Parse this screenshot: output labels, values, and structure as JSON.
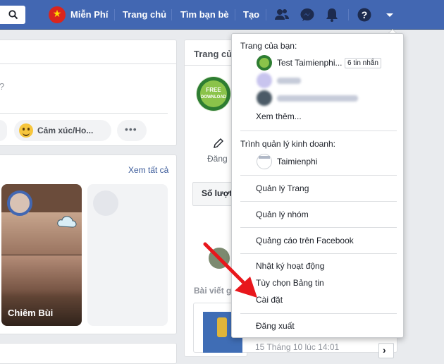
{
  "topbar": {
    "user_name": "Miễn Phí",
    "home": "Trang chủ",
    "find_friends": "Tìm bạn bè",
    "create": "Tạo"
  },
  "composer": {
    "prompt_fragment": "?",
    "feeling_label": "Cảm xúc/Ho..."
  },
  "stories": {
    "see_all": "Xem tất cả",
    "story_name": "Chiêm Bùi"
  },
  "right_panel": {
    "pages_title": "Trang củ",
    "edit_label": "Đăng",
    "views_label": "Số lượt",
    "posts_title": "Bài viết g",
    "post_date": "15 Tháng 10 lúc 14:01"
  },
  "dropdown": {
    "your_pages_heading": "Trang của bạn:",
    "pages": [
      {
        "name": "Test Taimienphi...",
        "badge": "6 tin nhắn"
      }
    ],
    "see_more": "Xem thêm...",
    "business_heading": "Trình quản lý kinh doanh:",
    "business_name": "Taimienphi",
    "items": [
      "Quản lý Trang",
      "Quản lý nhóm",
      "Quảng cáo trên Facebook",
      "Nhật ký hoạt động",
      "Tùy chọn Bảng tin",
      "Cài đặt",
      "Đăng xuất"
    ]
  },
  "colors": {
    "brand_blue": "#4267b2",
    "arrow_red": "#e8171c"
  }
}
